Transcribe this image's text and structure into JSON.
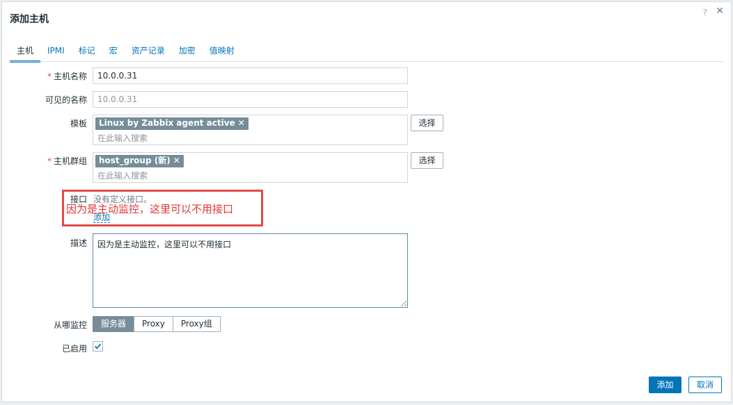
{
  "dialog": {
    "title": "添加主机",
    "help_icon": "?",
    "close_icon": "✕"
  },
  "tabs": [
    {
      "label": "主机",
      "active": true
    },
    {
      "label": "IPMI"
    },
    {
      "label": "标记"
    },
    {
      "label": "宏"
    },
    {
      "label": "资产记录"
    },
    {
      "label": "加密"
    },
    {
      "label": "值映射"
    }
  ],
  "form": {
    "host_name": {
      "label": "主机名称",
      "required_mark": "*",
      "value": "10.0.0.31"
    },
    "visible_name": {
      "label": "可见的名称",
      "placeholder": "10.0.0.31"
    },
    "templates": {
      "label": "模板",
      "tag": "Linux by Zabbix agent active",
      "remove": "✕",
      "search_placeholder": "在此输入搜索",
      "select_button": "选择"
    },
    "host_groups": {
      "label": "主机群组",
      "required_mark": "*",
      "tag": "host_group (新)",
      "remove": "✕",
      "search_placeholder": "在此输入搜索",
      "select_button": "选择"
    },
    "interfaces": {
      "label": "接口",
      "empty_text": "没有定义接口。",
      "add_link": "添加",
      "annotation": "因为是主动监控，这里可以不用接口"
    },
    "description": {
      "label": "描述",
      "value": "因为是主动监控，这里可以不用接口"
    },
    "monitored_by": {
      "label": "从哪监控",
      "options": [
        "服务器",
        "Proxy",
        "Proxy组"
      ],
      "selected": "服务器"
    },
    "enabled": {
      "label": "已启用",
      "checked": true
    }
  },
  "footer": {
    "add_button": "添加",
    "cancel_button": "取消"
  },
  "colors": {
    "accent": "#0275b8",
    "annotation_red": "#e43535",
    "tag_bg": "#768d99"
  }
}
